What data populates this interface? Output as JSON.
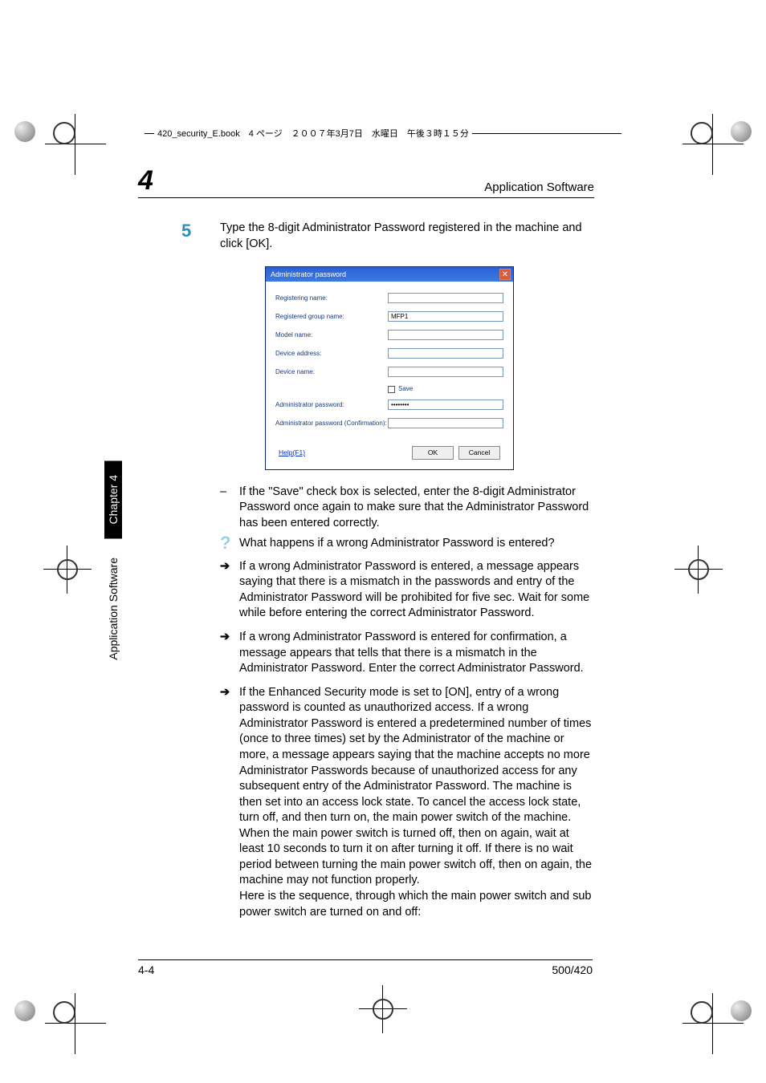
{
  "file_header": "420_security_E.book　4 ページ　２００７年3月7日　水曜日　午後３時１５分",
  "chapter_number": "4",
  "section_title": "Application Software",
  "step_number": "5",
  "step_text": "Type the 8-digit Administrator Password registered in the machine and click [OK].",
  "dialog": {
    "title": "Administrator password",
    "fields": {
      "registering_name": "Registering name:",
      "registered_group_name": "Registered group name:",
      "registered_group_value": "MFP1",
      "model_name": "Model name:",
      "device_address": "Device address:",
      "device_name": "Device name:",
      "save_label": "Save",
      "admin_pw": "Administrator password:",
      "admin_pw_value": "••••••••",
      "admin_pw_confirm": "Administrator password (Confirmation):"
    },
    "help": "Help(F1)",
    "ok": "OK",
    "cancel": "Cancel"
  },
  "bullets": {
    "dash1": "If the \"Save\" check box is selected, enter the 8-digit Administrator Password once again to make sure that the Administrator Password has been entered correctly.",
    "q1": "What happens if a wrong Administrator Password is entered?",
    "a1": "If a wrong Administrator Password is entered, a message appears saying that there is a mismatch in the passwords and entry of the Administrator Password will be prohibited for five sec. Wait for some while before entering the correct Administrator Password.",
    "a2": "If a wrong Administrator Password is entered for confirmation, a message appears that tells that there is a mismatch in the Administrator Password. Enter the correct Administrator Password.",
    "a3": "If the Enhanced Security mode is set to [ON], entry of a wrong password is counted as unauthorized access. If a wrong Administrator Password is entered a predetermined number of times (once to three times) set by the Administrator of the machine or more, a message appears saying that the machine accepts no more Administrator Passwords because of unauthorized access for any subsequent entry of the Administrator Password. The machine is then set into an access lock state. To cancel the access lock state, turn off, and then turn on, the main power switch of the machine. When the main power switch is turned off, then on again, wait at least 10 seconds to turn it on after turning it off. If there is no wait period between turning the main power switch off, then on again, the machine may not function properly.",
    "a3b": "Here is the sequence, through which the main power switch and sub power switch are turned on and off:"
  },
  "side_tab_chapter": "Chapter 4",
  "side_tab_section": "Application Software",
  "footer_page": "4-4",
  "footer_model": "500/420"
}
